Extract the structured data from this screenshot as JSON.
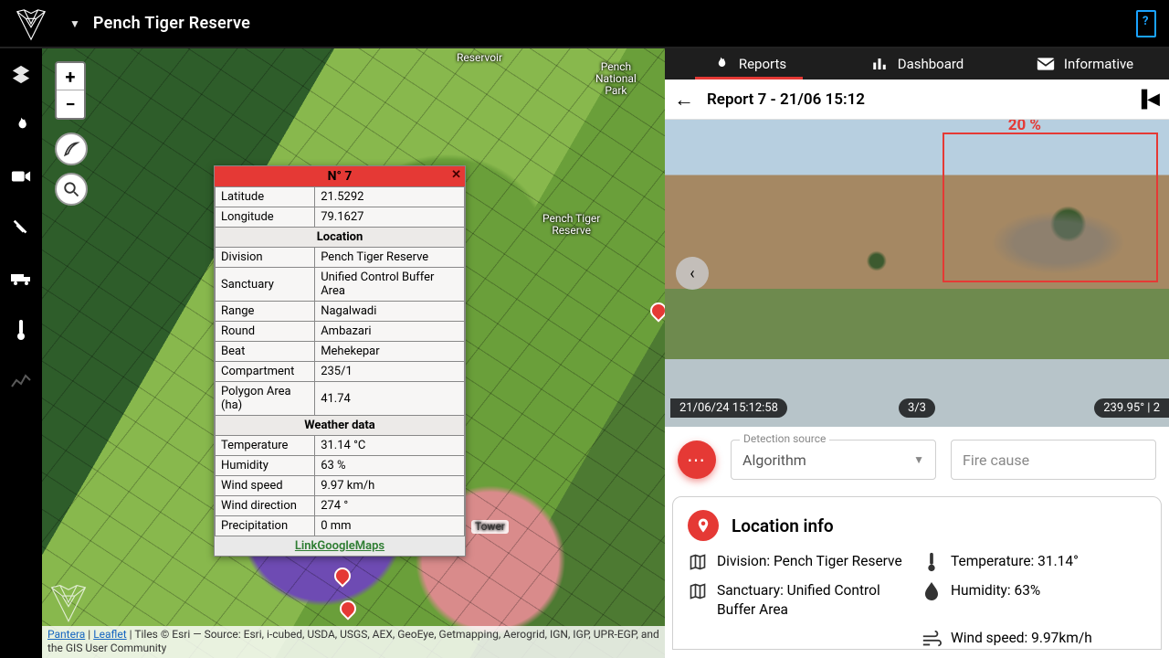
{
  "header": {
    "reserve_name": "Pench Tiger Reserve"
  },
  "tabs": {
    "reports": "Reports",
    "dashboard": "Dashboard",
    "informative": "Informative"
  },
  "map": {
    "labels": {
      "reservoir": "Reservoir",
      "pench_np": "Pench\nNational\nPark",
      "pench_tiger": "Pench Tiger\nReserve",
      "tower": "Tower"
    },
    "attribution_prefix": "Pantera",
    "attribution_leaflet": "Leaflet",
    "attribution_rest": " | Tiles © Esri — Source: Esri, i-cubed, USDA, USGS, AEX, GeoEye, Getmapping, Aerogrid, IGN, IGP, UPR-EGP, and the GIS User Community"
  },
  "popup": {
    "title": "N° 7",
    "latitude_label": "Latitude",
    "latitude": "21.5292",
    "longitude_label": "Longitude",
    "longitude": "79.1627",
    "section_location": "Location",
    "division_label": "Division",
    "division": "Pench Tiger Reserve",
    "sanctuary_label": "Sanctuary",
    "sanctuary": "Unified Control Buffer Area",
    "range_label": "Range",
    "range": "Nagalwadi",
    "round_label": "Round",
    "round": "Ambazari",
    "beat_label": "Beat",
    "beat": "Mehekepar",
    "compartment_label": "Compartment",
    "compartment": "235/1",
    "polyarea_label": "Polygon Area (ha)",
    "polyarea": "41.74",
    "section_weather": "Weather data",
    "temperature_label": "Temperature",
    "temperature": "31.14 °C",
    "humidity_label": "Humidity",
    "humidity": "63 %",
    "windspeed_label": "Wind speed",
    "windspeed": "9.97 km/h",
    "winddir_label": "Wind direction",
    "winddir": "274 °",
    "precip_label": "Precipitation",
    "precip": "0 mm",
    "gmaps": "LinkGoogleMaps"
  },
  "report": {
    "title": "Report 7 - 21/06 15:12",
    "detection_pct": "20 %",
    "timestamp": "21/06/24 15:12:58",
    "page": "3/3",
    "bearing": "239.95° | 2"
  },
  "form": {
    "detection_source_label": "Detection source",
    "detection_source_value": "Algorithm",
    "fire_cause_placeholder": "Fire cause"
  },
  "location_info": {
    "title": "Location info",
    "division": "Division: Pench Tiger Reserve",
    "sanctuary": "Sanctuary: Unified Control Buffer Area",
    "temperature": "Temperature: 31.14°",
    "humidity": "Humidity: 63%",
    "windspeed": "Wind speed: 9.97km/h"
  }
}
